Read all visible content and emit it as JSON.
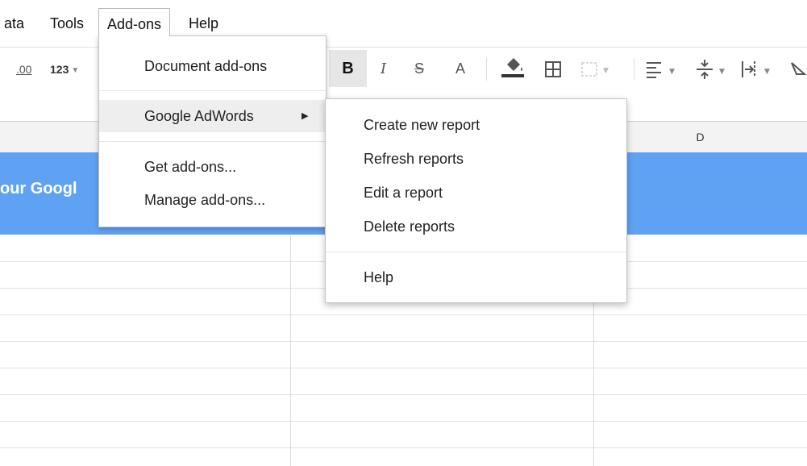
{
  "menubar": {
    "items": [
      {
        "label": "ata"
      },
      {
        "label": "Tools"
      },
      {
        "label": "Add-ons"
      },
      {
        "label": "Help"
      }
    ]
  },
  "toolbar": {
    "decimal_label": ".00",
    "format_label": "123",
    "bold_label": "B",
    "italic_label": "I",
    "strike_label": "S",
    "text_color_label": "A"
  },
  "addons_menu": {
    "items": [
      {
        "label": "Document add-ons"
      },
      {
        "label": "Google AdWords",
        "submenu_arrow": "▶"
      },
      {
        "label": "Get add-ons..."
      },
      {
        "label": "Manage add-ons..."
      }
    ]
  },
  "adwords_submenu": {
    "items": [
      {
        "label": "Create new report"
      },
      {
        "label": "Refresh reports"
      },
      {
        "label": "Edit a report"
      },
      {
        "label": "Delete reports"
      },
      {
        "label": "Help"
      }
    ]
  },
  "sheet": {
    "column_d_label": "D",
    "banner_text": "our Googl",
    "banner_color": "#5fa2f4"
  }
}
